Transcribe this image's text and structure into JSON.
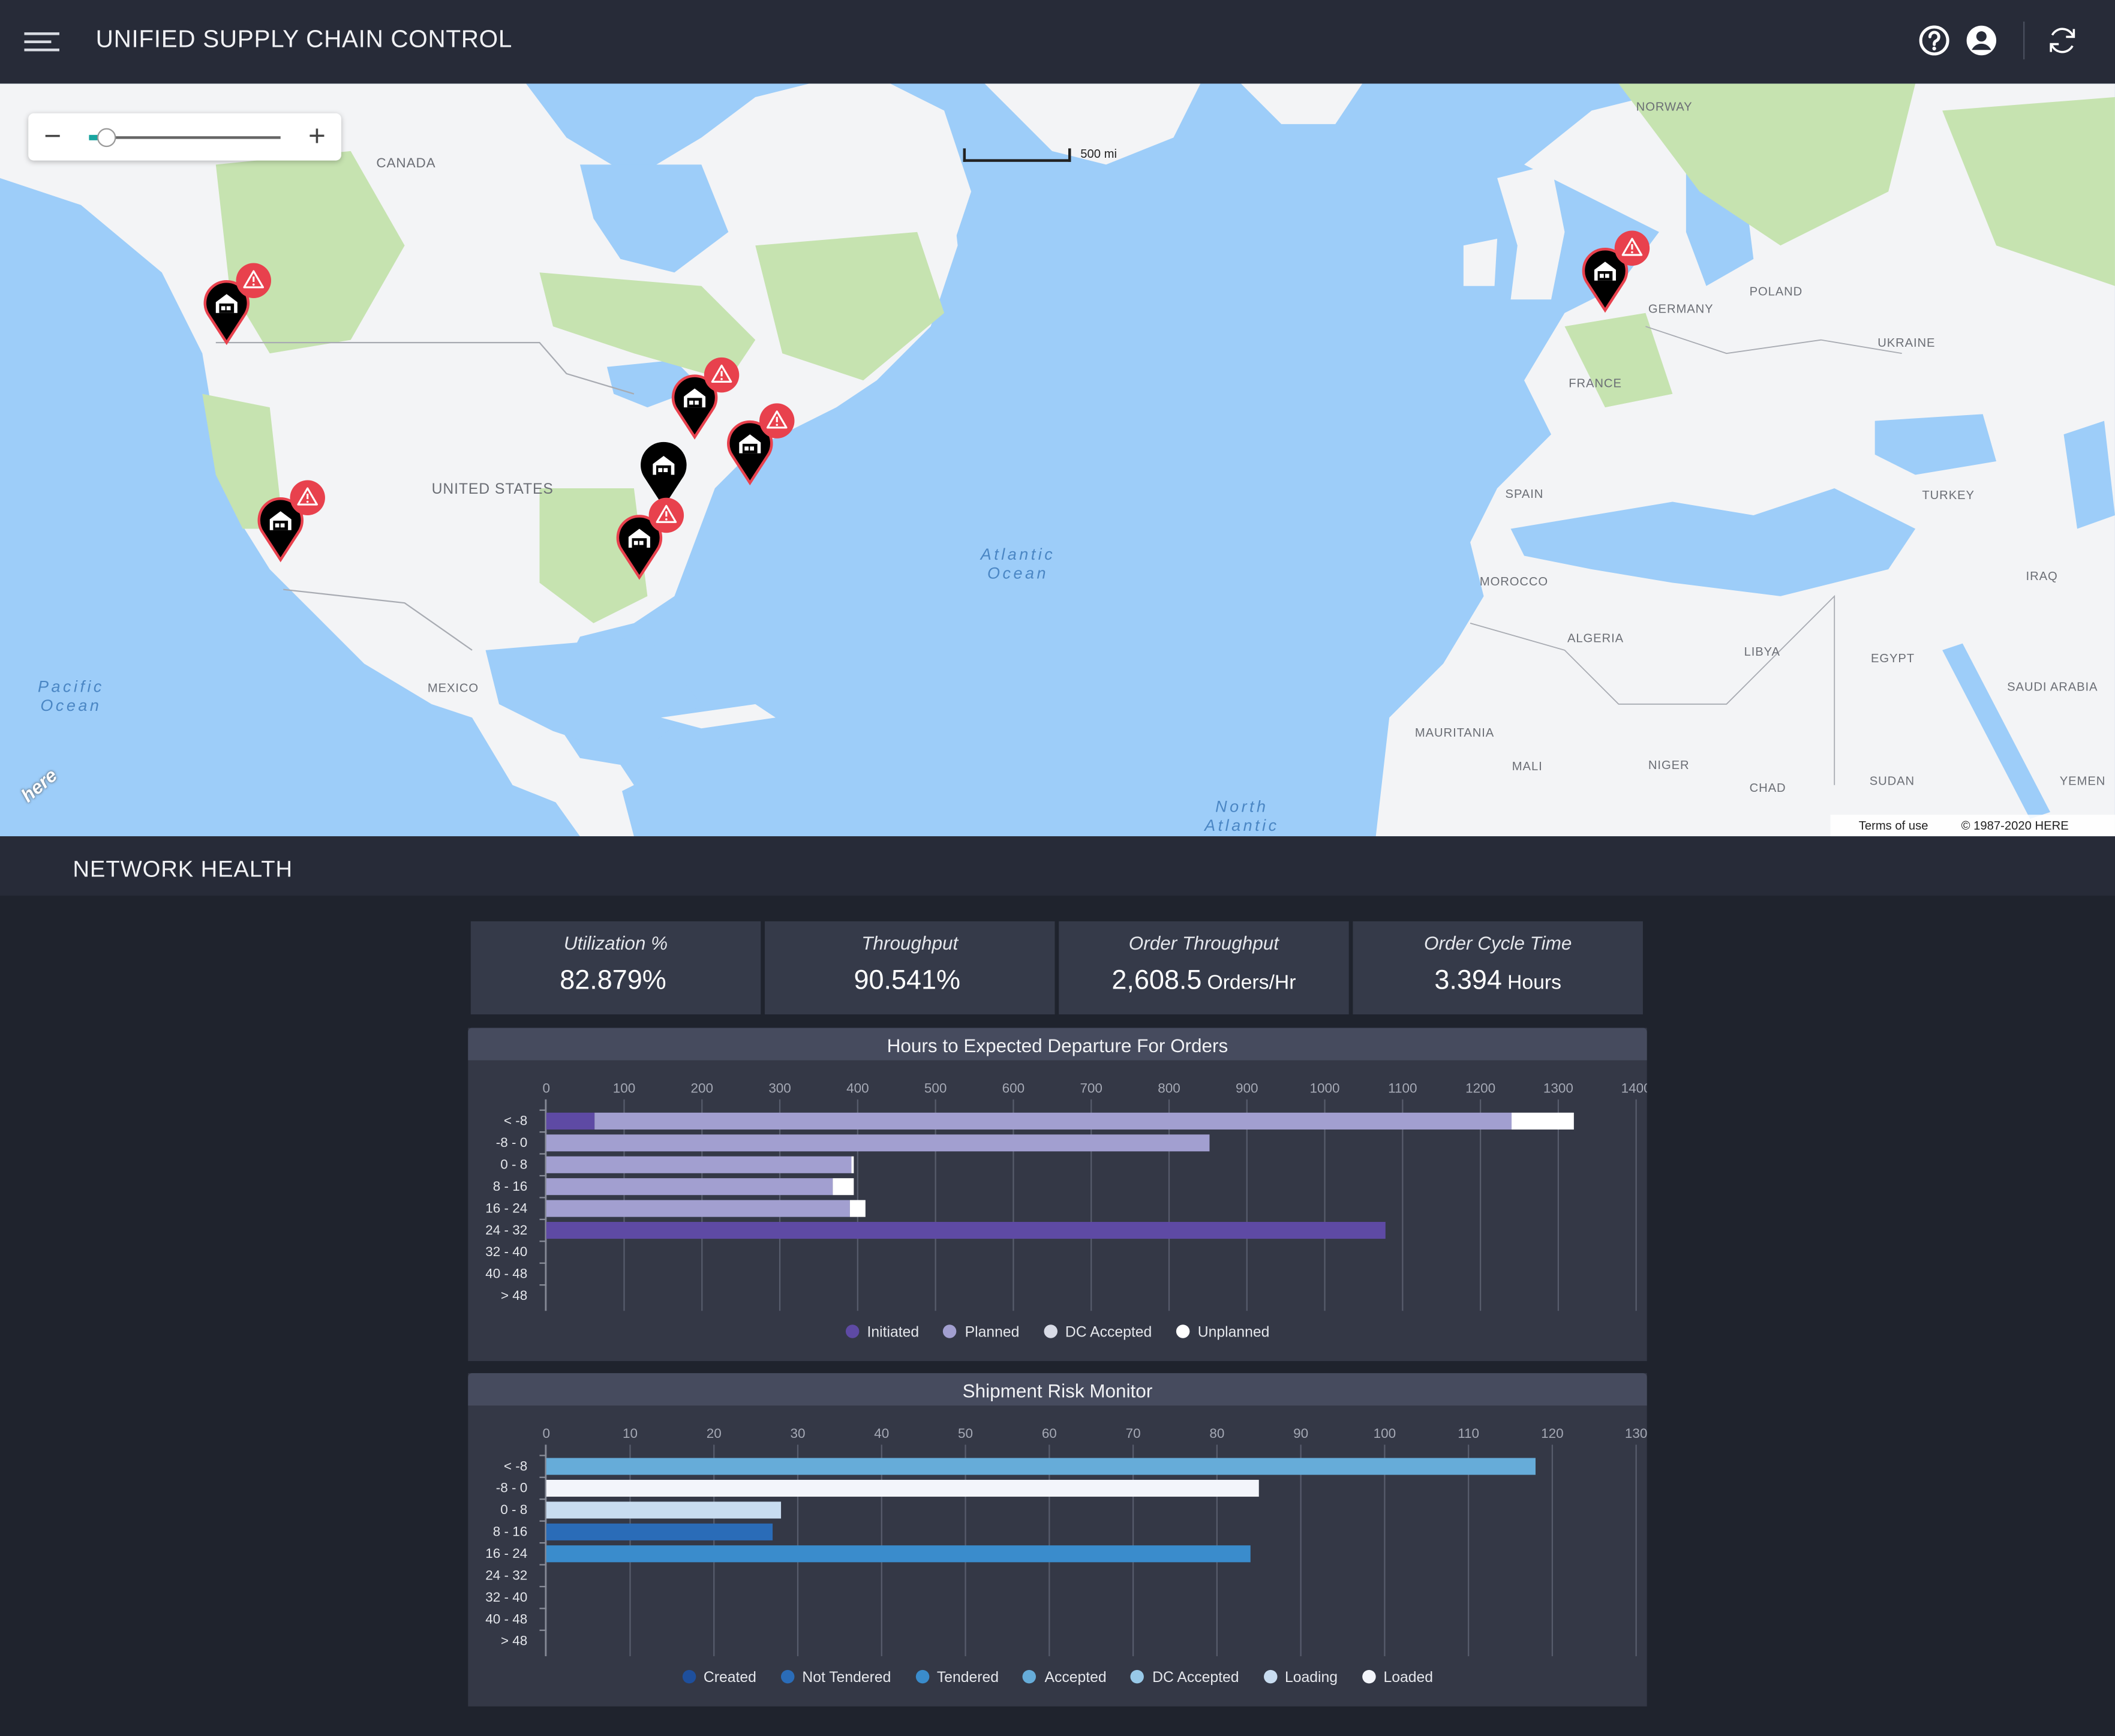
{
  "header": {
    "title": "UNIFIED SUPPLY CHAIN CONTROL"
  },
  "map": {
    "scale_label": "500 mi",
    "countries": [
      "CANADA",
      "UNITED STATES",
      "MEXICO",
      "NORWAY",
      "POLAND",
      "GERMANY",
      "UKRAINE",
      "FRANCE",
      "SPAIN",
      "TURKEY",
      "MOROCCO",
      "ALGERIA",
      "LIBYA",
      "EGYPT",
      "IRAQ",
      "SAUDI ARABIA",
      "MAURITANIA",
      "MALI",
      "NIGER",
      "CHAD",
      "SUDAN",
      "YEMEN"
    ],
    "oceans": [
      "Atlantic\nOcean",
      "Pacific\nOcean",
      "North\nAtlantic"
    ],
    "attribution": {
      "terms": "Terms of use",
      "copyright": "© 1987-2020 HERE"
    },
    "logo": "here"
  },
  "network_health": {
    "title": "NETWORK HEALTH",
    "kpis": [
      {
        "label": "Utilization %",
        "value": "82.879%",
        "unit": ""
      },
      {
        "label": "Throughput",
        "value": "90.541%",
        "unit": ""
      },
      {
        "label": "Order Throughput",
        "value": "2,608.5",
        "unit": "Orders/Hr"
      },
      {
        "label": "Order Cycle Time",
        "value": "3.394",
        "unit": "Hours"
      }
    ]
  },
  "chart_data": [
    {
      "type": "bar",
      "orientation": "horizontal",
      "stacked": true,
      "title": "Hours to Expected Departure For Orders",
      "categories": [
        "< -8",
        "-8 - 0",
        "0 - 8",
        "8 - 16",
        "16 - 24",
        "24 - 32",
        "32 - 40",
        "40 - 48",
        "> 48"
      ],
      "xlim": [
        0,
        1400
      ],
      "xticks": [
        0,
        100,
        200,
        300,
        400,
        500,
        600,
        700,
        800,
        900,
        1000,
        1100,
        1200,
        1300,
        1400
      ],
      "series": [
        {
          "name": "Initiated",
          "color": "#5e4aa4",
          "values": [
            62,
            0,
            0,
            0,
            0,
            1078,
            0,
            0,
            0
          ]
        },
        {
          "name": "Planned",
          "color": "#a29fd0",
          "values": [
            1178,
            852,
            392,
            368,
            390,
            0,
            0,
            0,
            0
          ]
        },
        {
          "name": "DC Accepted",
          "color": "#d8dbe6",
          "values": [
            0,
            0,
            0,
            0,
            0,
            0,
            0,
            0,
            0
          ]
        },
        {
          "name": "Unplanned",
          "color": "#ffffff",
          "values": [
            80,
            0,
            3,
            27,
            20,
            0,
            0,
            0,
            0
          ]
        }
      ]
    },
    {
      "type": "bar",
      "orientation": "horizontal",
      "stacked": true,
      "title": "Shipment Risk Monitor",
      "categories": [
        "< -8",
        "-8 - 0",
        "0 - 8",
        "8 - 16",
        "16 - 24",
        "24 - 32",
        "32 - 40",
        "40 - 48",
        "> 48"
      ],
      "xlim": [
        0,
        130
      ],
      "xticks": [
        0,
        10,
        20,
        30,
        40,
        50,
        60,
        70,
        80,
        90,
        100,
        110,
        120,
        130
      ],
      "series": [
        {
          "name": "Created",
          "color": "#1e4f9c",
          "values": [
            0,
            0,
            0,
            0,
            0,
            0,
            0,
            0,
            0
          ]
        },
        {
          "name": "Not Tendered",
          "color": "#2a6cb8",
          "values": [
            0,
            0,
            0,
            27,
            0,
            0,
            0,
            0,
            0
          ]
        },
        {
          "name": "Tendered",
          "color": "#3a8ccc",
          "values": [
            0,
            0,
            0,
            0,
            84,
            0,
            0,
            0,
            0
          ]
        },
        {
          "name": "Accepted",
          "color": "#66acd9",
          "values": [
            118,
            0,
            0,
            0,
            0,
            0,
            0,
            0,
            0
          ]
        },
        {
          "name": "DC Accepted",
          "color": "#98c9e8",
          "values": [
            0,
            0,
            0,
            0,
            0,
            0,
            0,
            0,
            0
          ]
        },
        {
          "name": "Loading",
          "color": "#c8dcf0",
          "values": [
            0,
            0,
            28,
            0,
            0,
            0,
            0,
            0,
            0
          ]
        },
        {
          "name": "Loaded",
          "color": "#f3f5fb",
          "values": [
            0,
            85,
            0,
            0,
            0,
            0,
            0,
            0,
            0
          ]
        }
      ]
    }
  ],
  "colors": {
    "header_bg": "#272b38",
    "page_bg": "#1f232d",
    "panel_bg": "#343846",
    "pin_alert": "#e8414d",
    "pin_body": "#000000",
    "ocean": "#9dcdf9",
    "land": "#f3f4f6",
    "forest": "#c6e3b0"
  },
  "icons": {
    "help": "help-circle-icon",
    "user": "user-circle-icon",
    "refresh": "refresh-icon",
    "menu": "hamburger-icon",
    "pin": "warehouse-pin-icon",
    "alert": "warning-triangle-icon"
  }
}
